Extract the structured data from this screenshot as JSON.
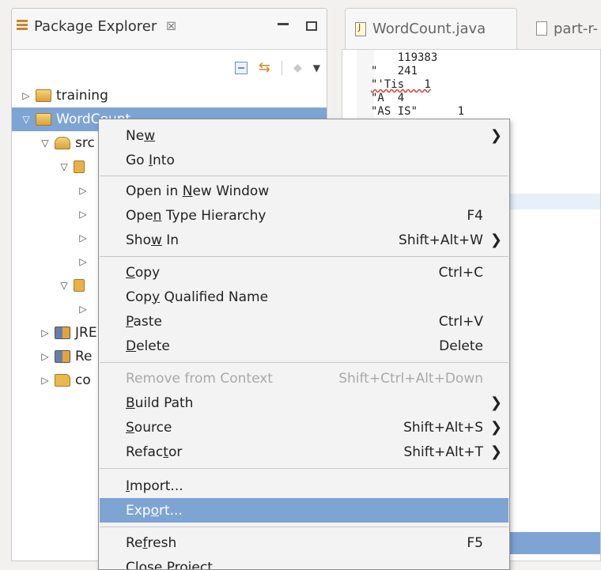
{
  "package_explorer": {
    "title": "Package Explorer",
    "close_glyph": "☒",
    "tree": [
      {
        "label": "training",
        "twist": "▷"
      },
      {
        "label": "WordCount",
        "twist": "▽",
        "selected": true
      },
      {
        "label": "src",
        "twist": "▽"
      },
      {
        "label": "",
        "twist": "▽"
      },
      {
        "label": "",
        "twist": "▷"
      },
      {
        "label": "",
        "twist": "▷"
      },
      {
        "label": "",
        "twist": "▷"
      },
      {
        "label": "",
        "twist": "▷"
      },
      {
        "label": "",
        "twist": "▽"
      },
      {
        "label": "",
        "twist": "▷"
      },
      {
        "label": "JRE",
        "twist": "▷"
      },
      {
        "label": "Re",
        "twist": "▷"
      },
      {
        "label": "co",
        "twist": "▷"
      }
    ]
  },
  "editor": {
    "tabs": [
      "WordCount.java",
      "part-r-"
    ],
    "code_lines": [
      "    119383",
      "\"   241",
      "\"'Tis   1",
      "\"A  4",
      "\"AS IS\"      1"
    ]
  },
  "context_menu": {
    "items": [
      {
        "pre": "Ne",
        "ul": "w",
        "post": "",
        "accel": "",
        "submenu": true
      },
      {
        "pre": "Go ",
        "ul": "I",
        "post": "nto",
        "accel": ""
      },
      {
        "pre": "Open in ",
        "ul": "N",
        "post": "ew Window",
        "accel": ""
      },
      {
        "pre": "Ope",
        "ul": "n",
        "post": " Type Hierarchy",
        "accel": "F4"
      },
      {
        "pre": "Sho",
        "ul": "w",
        "post": " In",
        "accel": "Shift+Alt+W",
        "submenu": true
      },
      {
        "pre": "",
        "ul": "C",
        "post": "opy",
        "accel": "Ctrl+C"
      },
      {
        "pre": "Cop",
        "ul": "y",
        "post": " Qualified Name",
        "accel": ""
      },
      {
        "pre": "",
        "ul": "P",
        "post": "aste",
        "accel": "Ctrl+V"
      },
      {
        "pre": "",
        "ul": "D",
        "post": "elete",
        "accel": "Delete"
      },
      {
        "pre": "Remove from Context",
        "ul": "",
        "post": "",
        "accel": "Shift+Ctrl+Alt+Down",
        "disabled": true
      },
      {
        "pre": "",
        "ul": "B",
        "post": "uild Path",
        "accel": "",
        "submenu": true
      },
      {
        "pre": "",
        "ul": "S",
        "post": "ource",
        "accel": "Shift+Alt+S",
        "submenu": true
      },
      {
        "pre": "Refac",
        "ul": "t",
        "post": "or",
        "accel": "Shift+Alt+T",
        "submenu": true
      },
      {
        "pre": "",
        "ul": "I",
        "post": "mport...",
        "accel": ""
      },
      {
        "pre": "Exp",
        "ul": "o",
        "post": "rt...",
        "accel": "",
        "highlighted": true
      },
      {
        "pre": "Re",
        "ul": "f",
        "post": "resh",
        "accel": "F5"
      },
      {
        "pre": "Close Project",
        "ul": "",
        "post": "",
        "accel": ""
      }
    ],
    "submenu_glyph": "❯"
  },
  "colors": {
    "selection": "#7ea4d4",
    "menu_bg": "#f3f3f3",
    "disabled_text": "#a9a9a9"
  }
}
